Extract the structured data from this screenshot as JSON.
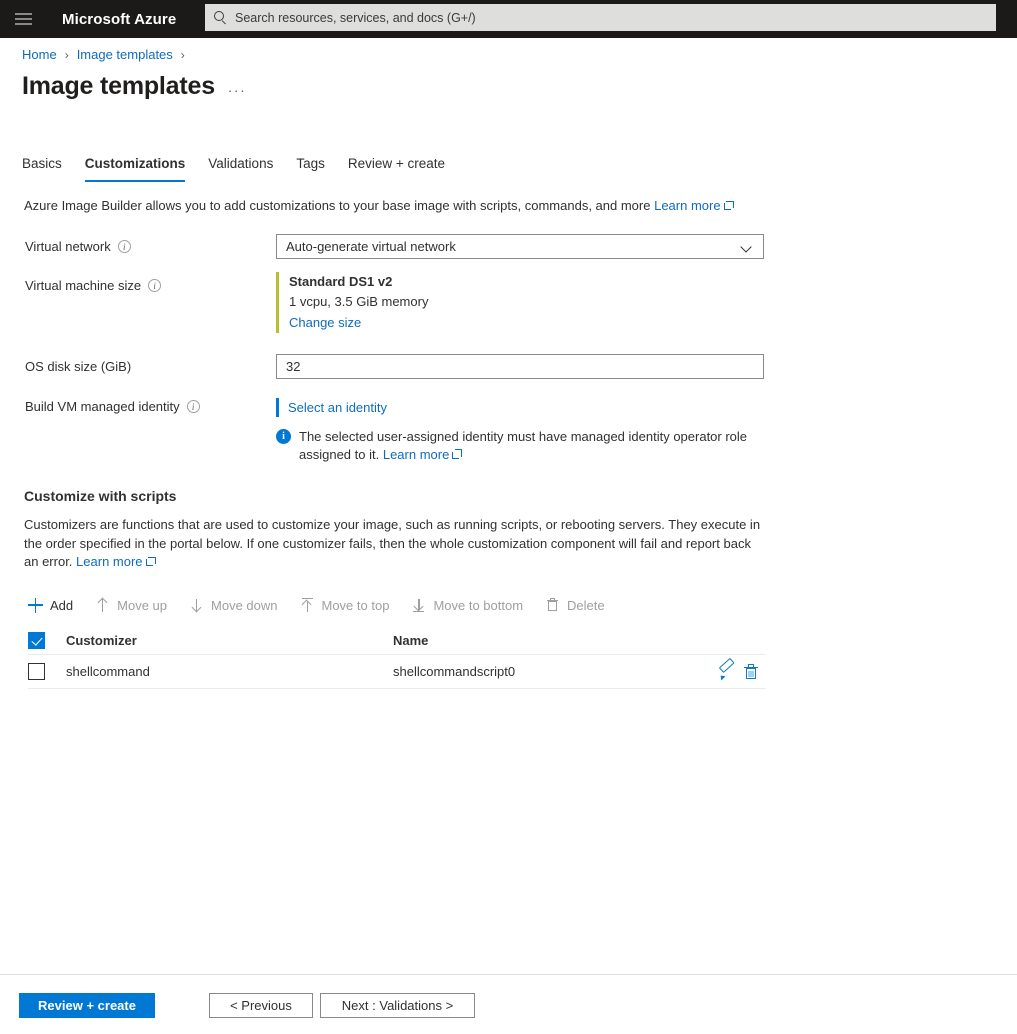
{
  "topbar": {
    "menu_icon": "hamburger-icon",
    "brand": "Microsoft Azure",
    "search_icon": "search-icon",
    "search_placeholder": "Search resources, services, and docs (G+/)"
  },
  "breadcrumb": {
    "items": [
      {
        "label": "Home"
      },
      {
        "label": "Image templates"
      }
    ],
    "separator": "›"
  },
  "page": {
    "title": "Image templates",
    "ellipsis": "···"
  },
  "tabs": [
    {
      "label": "Basics",
      "active": false
    },
    {
      "label": "Customizations",
      "active": true
    },
    {
      "label": "Validations",
      "active": false
    },
    {
      "label": "Tags",
      "active": false
    },
    {
      "label": "Review + create",
      "active": false
    }
  ],
  "description": {
    "text": "Azure Image Builder allows you to add customizations to your base image with scripts, commands, and more",
    "link": "Learn more"
  },
  "form": {
    "virtual_network": {
      "label": "Virtual network",
      "info_icon": "info-circle-icon",
      "value": "Auto-generate virtual network",
      "chevron_icon": "chevron-down-icon"
    },
    "vm_size": {
      "label": "Virtual machine size",
      "info_icon": "info-circle-icon",
      "name": "Standard DS1 v2",
      "spec": "1 vcpu, 3.5 GiB memory",
      "change_link": "Change size",
      "accent_color": "#b6bf2f"
    },
    "os_disk": {
      "label": "OS disk size (GiB)",
      "value": "32",
      "placeholder": ""
    },
    "managed_identity": {
      "label": "Build VM managed identity",
      "info_icon": "info-circle-icon",
      "select_link": "Select an identity",
      "accent_color": "#0078d4",
      "notice_icon": "info-filled-icon",
      "notice_text": "The selected user-assigned identity must have managed identity operator role assigned to it.",
      "notice_link": "Learn more"
    }
  },
  "customize": {
    "heading": "Customize with scripts",
    "body": "Customizers are functions that are used to customize your image, such as running scripts, or rebooting servers. They execute in the order specified in the portal below. If one customizer fails, then the whole customization component will fail and report back an error.",
    "body_link": "Learn more",
    "toolbar": [
      {
        "label": "Add",
        "icon": "plus-icon",
        "disabled": false
      },
      {
        "label": "Move up",
        "icon": "arrow-up-icon",
        "disabled": true
      },
      {
        "label": "Move down",
        "icon": "arrow-down-icon",
        "disabled": true
      },
      {
        "label": "Move to top",
        "icon": "arrow-to-top-icon",
        "disabled": true
      },
      {
        "label": "Move to bottom",
        "icon": "arrow-to-bottom-icon",
        "disabled": true
      },
      {
        "label": "Delete",
        "icon": "trash-icon",
        "disabled": true
      }
    ],
    "table": {
      "select_all_checked": true,
      "columns": [
        "Customizer",
        "Name"
      ],
      "rows": [
        {
          "checked": false,
          "customizer": "shellcommand",
          "name": "shellcommandscript0",
          "edit_icon": "pencil-icon",
          "delete_icon": "trash-icon"
        }
      ]
    }
  },
  "footer": {
    "review_create": "Review + create",
    "previous": "< Previous",
    "next": "Next : Validations >",
    "primary_color": "#0078d4"
  }
}
